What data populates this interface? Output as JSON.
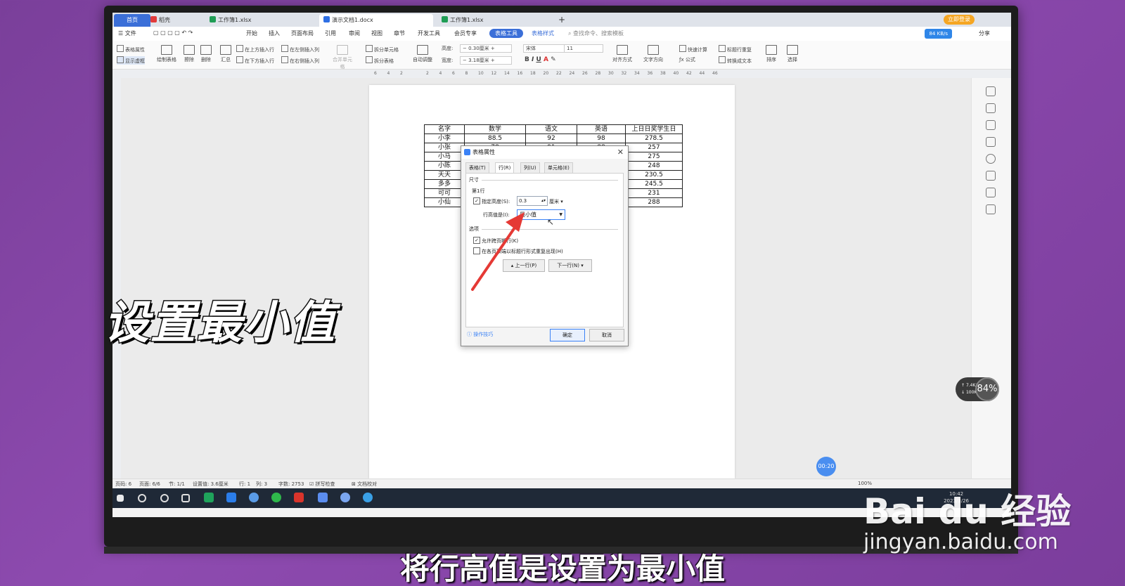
{
  "tabs": [
    {
      "label": "首页"
    },
    {
      "label": "稻壳",
      "color": "#e23b3b"
    },
    {
      "label": "工作簿1.xlsx",
      "color": "#1f9d55"
    },
    {
      "label": "演示文档1.docx",
      "color": "#2f6fe4"
    },
    {
      "label": "工作簿1.xlsx",
      "color": "#1f9d55"
    }
  ],
  "login_badge": "立即登录",
  "menu": [
    "文件",
    "开始",
    "插入",
    "页面布局",
    "引用",
    "审阅",
    "视图",
    "章节",
    "开发工具",
    "会员专享",
    "表格工具",
    "表格样式"
  ],
  "search_placeholder": "查找命令、搜索模板",
  "net_speed": "84 KB/s",
  "share_label": "分享",
  "ribbon": {
    "table_props": "表格属性",
    "show_gridlines": "显示虚框",
    "draw_table": "绘制表格",
    "erase": "擦除",
    "delete": "删除",
    "summary": "汇总",
    "insert_above": "在上方插入行",
    "insert_below": "在下方插入行",
    "insert_left": "在左侧插入列",
    "insert_right": "在右侧插入列",
    "merge_cells": "合并单元格",
    "split_cells": "拆分单元格",
    "split_table": "拆分表格",
    "auto_adjust": "自动调整",
    "height_label": "高度:",
    "height_value": "0.30厘米",
    "width_label": "宽度:",
    "width_value": "3.18厘米",
    "font_name": "宋体",
    "font_size": "11",
    "align": "对齐方式",
    "text_dir": "文字方向",
    "quick_calc": "快速计算",
    "title_repeat": "标题行重复",
    "formula": "公式",
    "to_text": "转换成文本",
    "sort": "排序",
    "select": "选择"
  },
  "ruler_ticks": [
    "6",
    "4",
    "2",
    "",
    "2",
    "4",
    "6",
    "8",
    "10",
    "12",
    "14",
    "16",
    "18",
    "20",
    "22",
    "24",
    "26",
    "28",
    "30",
    "32",
    "34",
    "36",
    "38",
    "40",
    "42",
    "44",
    "46"
  ],
  "table": {
    "header": [
      "名字",
      "数学",
      "语文",
      "英语",
      "上日日奖学生日"
    ],
    "rows": [
      [
        "小李",
        "88.5",
        "92",
        "98",
        "278.5"
      ],
      [
        "小张",
        "78",
        "91",
        "88",
        "257"
      ],
      [
        "小马",
        "",
        "",
        "",
        "275"
      ],
      [
        "小陈",
        "",
        "",
        "",
        "248"
      ],
      [
        "天天",
        "",
        "",
        "",
        "230.5"
      ],
      [
        "多多",
        "",
        "",
        "",
        "245.5"
      ],
      [
        "可可",
        "",
        "",
        "",
        "231"
      ],
      [
        "小仙",
        "",
        "",
        "",
        "288"
      ]
    ]
  },
  "dialog": {
    "title": "表格属性",
    "tabs": [
      "表格(T)",
      "行(R)",
      "列(U)",
      "单元格(E)"
    ],
    "active_tab": "行(R)",
    "section_size": "尺寸",
    "row_label": "第1行",
    "specify_height": "指定高度(S):",
    "height_value": "0.3",
    "unit": "厘米",
    "row_height_is": "行高值是(I):",
    "row_height_option": "最小值",
    "section_options": "选项",
    "allow_break": "允许跨页断行(K)",
    "repeat_header": "在各页顶端以标题行形式重复出现(H)",
    "prev_row": "上一行(P)",
    "next_row": "下一行(N)",
    "tips": "操作技巧",
    "ok": "确定",
    "cancel": "取消"
  },
  "status": {
    "page_no": "页码: 6",
    "pages": "页面: 6/6",
    "section": "节: 1/1",
    "setting": "设置值: 3.6厘米",
    "row": "行: 1",
    "col": "列: 3",
    "words": "字数: 2753",
    "spell": "拼写检查",
    "proof": "文档校对",
    "zoom": "100%"
  },
  "taskbar_clock": {
    "time": "10:42",
    "date": "2023/3/26"
  },
  "timer": "00:20",
  "net_widget": {
    "up": "7.4K/s",
    "down": "100K/s",
    "percent": "84%"
  },
  "overlay_title": "设置最小值",
  "subtitle": "将行高值是设置为最小值",
  "watermark": {
    "logo": "Bai du 经验",
    "url": "jingyan.baidu.com"
  }
}
